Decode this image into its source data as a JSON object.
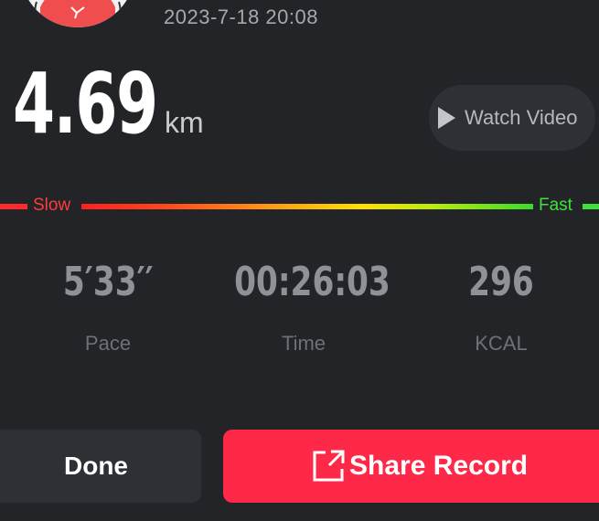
{
  "header": {
    "avatar_icon": "runner-avatar-icon",
    "datetime": "2023-7-18 20:08"
  },
  "distance": {
    "value": "4.69",
    "unit": "km"
  },
  "watch_video": {
    "icon": "play-icon",
    "label": "Watch Video"
  },
  "pace_bar": {
    "slow_label": "Slow",
    "fast_label": "Fast",
    "colors": {
      "slow": "#ff2b2b",
      "mid": "#ffe000",
      "fast": "#3fe03a"
    }
  },
  "stats": {
    "pace": {
      "value": "5′33′′",
      "label": "Pace"
    },
    "time": {
      "value": "00:26:03",
      "label": "Time"
    },
    "kcal": {
      "value": "296",
      "label": "KCAL"
    }
  },
  "actions": {
    "done_label": "Done",
    "share_label": "Share Record",
    "share_icon": "share-export-icon"
  },
  "colors": {
    "background": "#222427",
    "accent": "#fe2948",
    "secondary_button": "#2e3035"
  }
}
